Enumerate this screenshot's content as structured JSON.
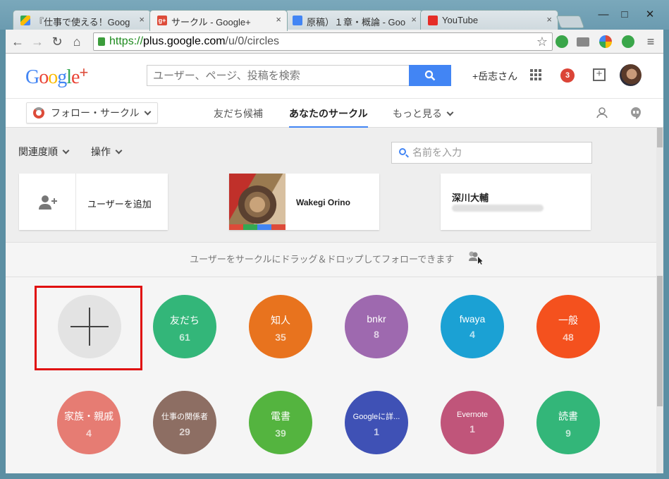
{
  "browser": {
    "tabs": [
      {
        "title": "『仕事で使える！Goog",
        "favicon_color": "#34a853"
      },
      {
        "title": "サークル - Google+",
        "favicon_color": "#dd4b39",
        "active": true
      },
      {
        "title": "原稿）１章・概論 - Goo",
        "favicon_color": "#4285f4"
      },
      {
        "title": "YouTube",
        "favicon_color": "#e52d27"
      }
    ],
    "tab_close": "×",
    "window_buttons": {
      "minimize": "—",
      "maximize": "□",
      "close": "✕"
    },
    "url": {
      "scheme": "https://",
      "host": "plus.google.com",
      "path": "/u/0/circles"
    },
    "nav": {
      "back": "←",
      "forward": "→",
      "reload": "↻",
      "home": "⌂",
      "star": "☆",
      "menu": "≡"
    }
  },
  "header": {
    "logo_text": "Google",
    "logo_plus": "+",
    "search_placeholder": "ユーザー、ページ、投稿を検索",
    "user_name": "+岳志さん",
    "notification_count": "3",
    "share_symbol": "+"
  },
  "subnav": {
    "follow_label": "フォロー・サークル",
    "tabs": [
      {
        "label": "友だち候補"
      },
      {
        "label": "あなたのサークル",
        "active": true
      },
      {
        "label": "もっと見る"
      }
    ]
  },
  "toolbar": {
    "sort_label": "関連度順",
    "actions_label": "操作",
    "name_placeholder": "名前を入力"
  },
  "cards": {
    "add_user": "ユーザーを追加",
    "person1": "Wakegi Orino",
    "person2": "深川大輔"
  },
  "dropbar_text": "ユーザーをサークルにドラッグ＆ドロップしてフォローできます",
  "circles": [
    {
      "name": "友だち",
      "count": "61",
      "color": "#33b679"
    },
    {
      "name": "知人",
      "count": "35",
      "color": "#e8731e"
    },
    {
      "name": "bnkr",
      "count": "8",
      "color": "#9e69af"
    },
    {
      "name": "fwaya",
      "count": "4",
      "color": "#1ba1d4"
    },
    {
      "name": "一般",
      "count": "48",
      "color": "#f4511e"
    },
    {
      "name": "家族・親戚",
      "count": "4",
      "color": "#e67c73"
    },
    {
      "name": "仕事の関係者",
      "count": "29",
      "color": "#8d6e63"
    },
    {
      "name": "電書",
      "count": "39",
      "color": "#54b43f"
    },
    {
      "name": "Googleに詳...",
      "count": "1",
      "color": "#3f51b5"
    },
    {
      "name": "Evernote",
      "count": "1",
      "color": "#c0557a"
    },
    {
      "name": "読書",
      "count": "9",
      "color": "#33b679"
    }
  ]
}
